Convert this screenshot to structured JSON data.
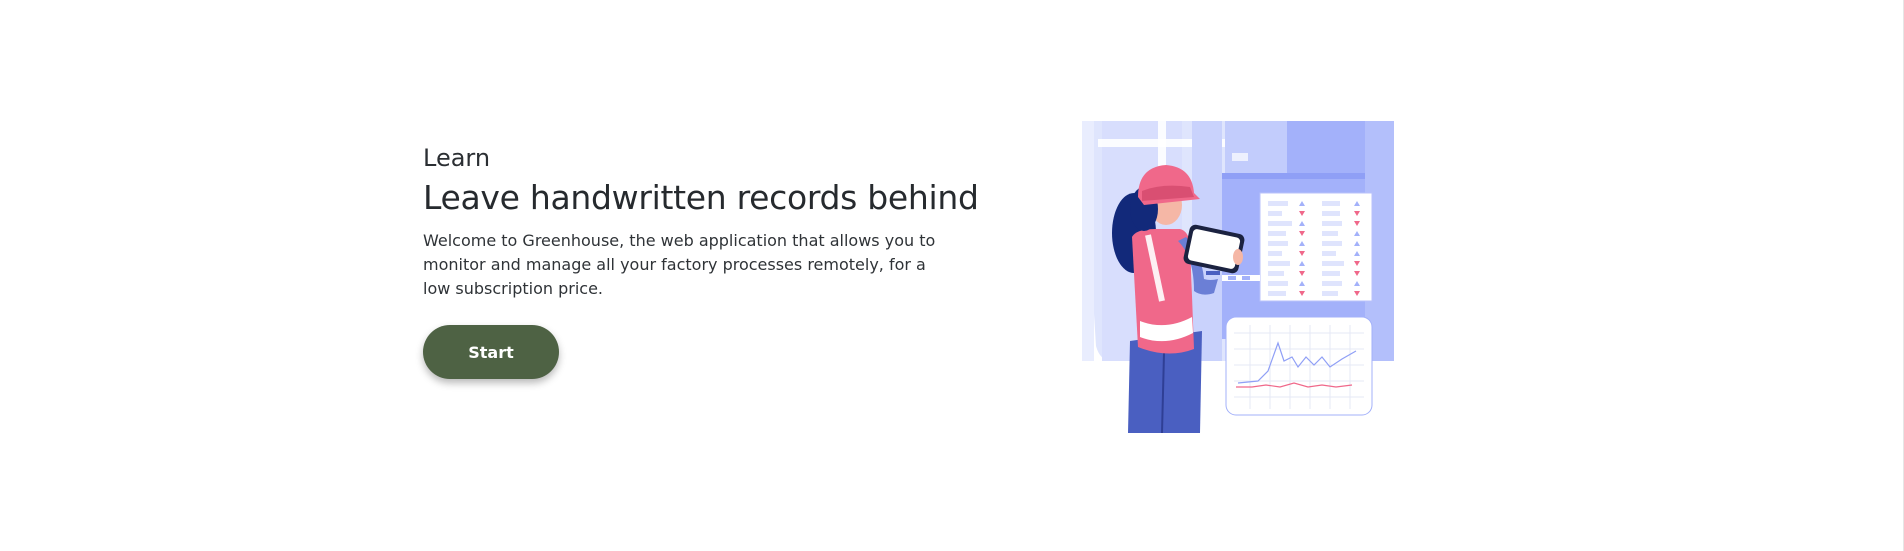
{
  "hero": {
    "eyebrow": "Learn",
    "headline": "Leave handwritten records behind",
    "description": "Welcome to Greenhouse, the web application that allows you to monitor and manage all your factory processes remotely, for a low subscription price.",
    "start_label": "Start"
  },
  "colors": {
    "button": "#4e6244",
    "accent_blue": "#a3b1fa",
    "accent_pink": "#f0688a",
    "worker_blue": "#4a5fc1",
    "hair_navy": "#12297a"
  },
  "illustration": {
    "icon": "factory-worker-tablet-illustration"
  }
}
